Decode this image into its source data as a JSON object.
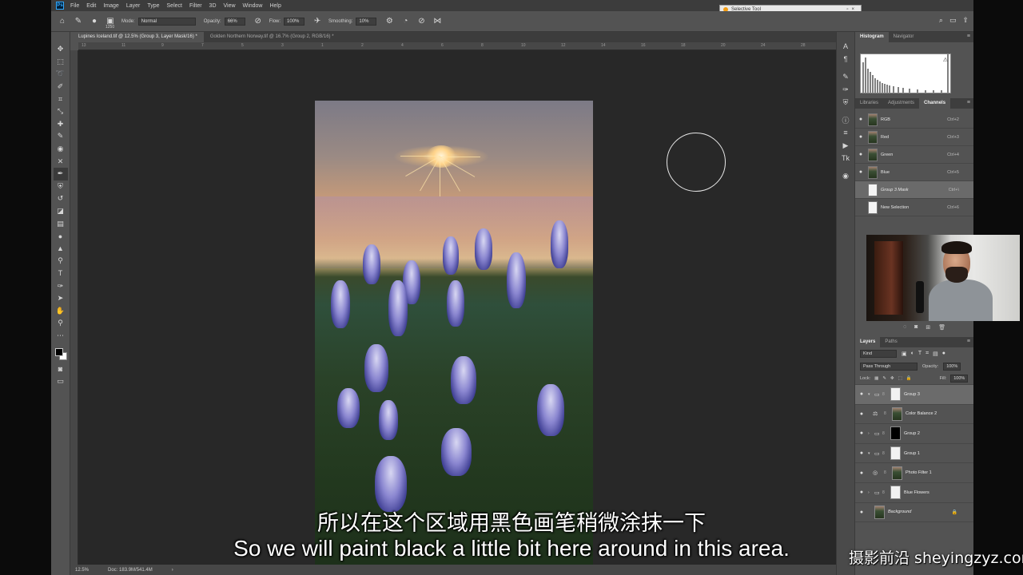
{
  "menu": {
    "items": [
      "File",
      "Edit",
      "Image",
      "Layer",
      "Type",
      "Select",
      "Filter",
      "3D",
      "View",
      "Window",
      "Help"
    ]
  },
  "selective_tool": {
    "title": "Selective Tool"
  },
  "options": {
    "brush_size": "1250",
    "mode_label": "Mode:",
    "mode_value": "Normal",
    "opacity_label": "Opacity:",
    "opacity_value": "66%",
    "flow_label": "Flow:",
    "flow_value": "100%",
    "smoothing_label": "Smoothing:",
    "smoothing_value": "10%"
  },
  "tabs": [
    {
      "label": "Lupines Iceland.tif @ 12.5% (Group 3, Layer Mask/16) *"
    },
    {
      "label": "Golden Northern Norway.tif @ 16.7% (Group 2, RGB/16) *"
    }
  ],
  "status": {
    "zoom": "12.5%",
    "doc": "Doc: 183.9M/541.4M"
  },
  "panels": {
    "top_tabs": [
      "Histogram",
      "Navigator"
    ],
    "mid_tabs": [
      "Libraries",
      "Adjustments",
      "Channels"
    ],
    "channels": [
      {
        "name": "RGB",
        "key": "Ctrl+2"
      },
      {
        "name": "Red",
        "key": "Ctrl+3"
      },
      {
        "name": "Green",
        "key": "Ctrl+4"
      },
      {
        "name": "Blue",
        "key": "Ctrl+5"
      },
      {
        "name": "Group 3 Mask",
        "key": "Ctrl+\\"
      },
      {
        "name": "New Selection",
        "key": "Ctrl+6"
      }
    ],
    "layer_tabs": [
      "Layers",
      "Paths"
    ],
    "kind_label": "Kind",
    "blend_mode": "Pass Through",
    "opacity_label": "Opacity:",
    "opacity_value": "100%",
    "lock_label": "Lock:",
    "fill_label": "Fill:",
    "fill_value": "100%",
    "layers": [
      {
        "name": "Group 3"
      },
      {
        "name": "Color Balance 2"
      },
      {
        "name": "Group 2"
      },
      {
        "name": "Group 1"
      },
      {
        "name": "Photo Filter 1"
      },
      {
        "name": "Blue Flowers"
      },
      {
        "name": "Background"
      }
    ]
  },
  "subtitles": {
    "chinese": "所以在这个区域用黑色画笔稍微涂抹一下",
    "english": "So we will paint black a little bit here around in this area."
  },
  "watermark": "摄影前沿 sheyingzyz.com",
  "colors": {
    "ps_blue": "#31a8ff",
    "panel_bg": "#535353",
    "canvas_bg": "#282828"
  }
}
